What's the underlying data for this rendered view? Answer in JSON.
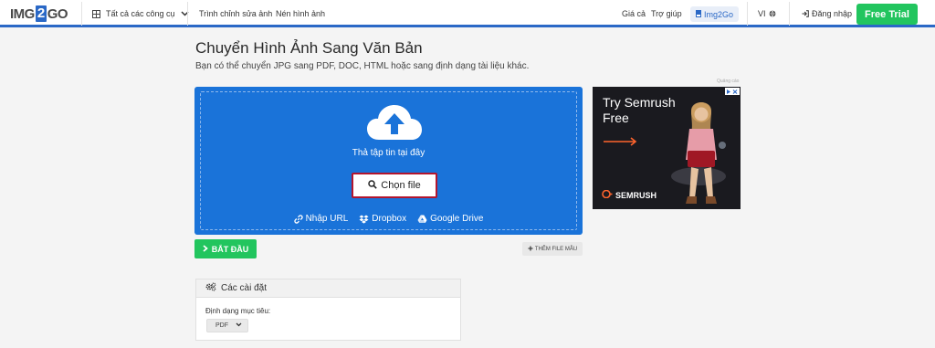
{
  "navbar": {
    "logo_left": "IMG",
    "logo_mid": "2",
    "logo_right": "GO",
    "all_tools": "Tất cả các công cụ",
    "photo_editor": "Trình chỉnh sửa ảnh",
    "compress": "Nén hình ảnh",
    "pricing": "Giá cả",
    "help": "Trợ giúp",
    "img2go": "Img2Go",
    "lang": "VI",
    "login": "Đăng nhập",
    "free_trial": "Free Trial"
  },
  "page": {
    "title": "Chuyển Hình Ảnh Sang Văn Bản",
    "subtitle": "Bạn có thể chuyển JPG sang PDF, DOC, HTML hoặc sang định dạng tài liệu khác."
  },
  "upload": {
    "drop_text": "Thả tập tin tại đây",
    "choose_file": "Chọn file",
    "url": "Nhập URL",
    "dropbox": "Dropbox",
    "gdrive": "Google Drive"
  },
  "actions": {
    "start": "BẮT ĐẦU",
    "sample": "THÊM FILE MẪU"
  },
  "settings": {
    "header": "Các cài đặt",
    "target_label": "Định dạng mục tiêu:",
    "format": "PDF"
  },
  "ad": {
    "label": "Quảng cáo",
    "headline_1": "Try Semrush",
    "headline_2": "Free",
    "brand": "SEMRUSH"
  },
  "colors": {
    "accent": "#1a73d9",
    "green": "#22c55e",
    "highlight": "#b3152e"
  }
}
